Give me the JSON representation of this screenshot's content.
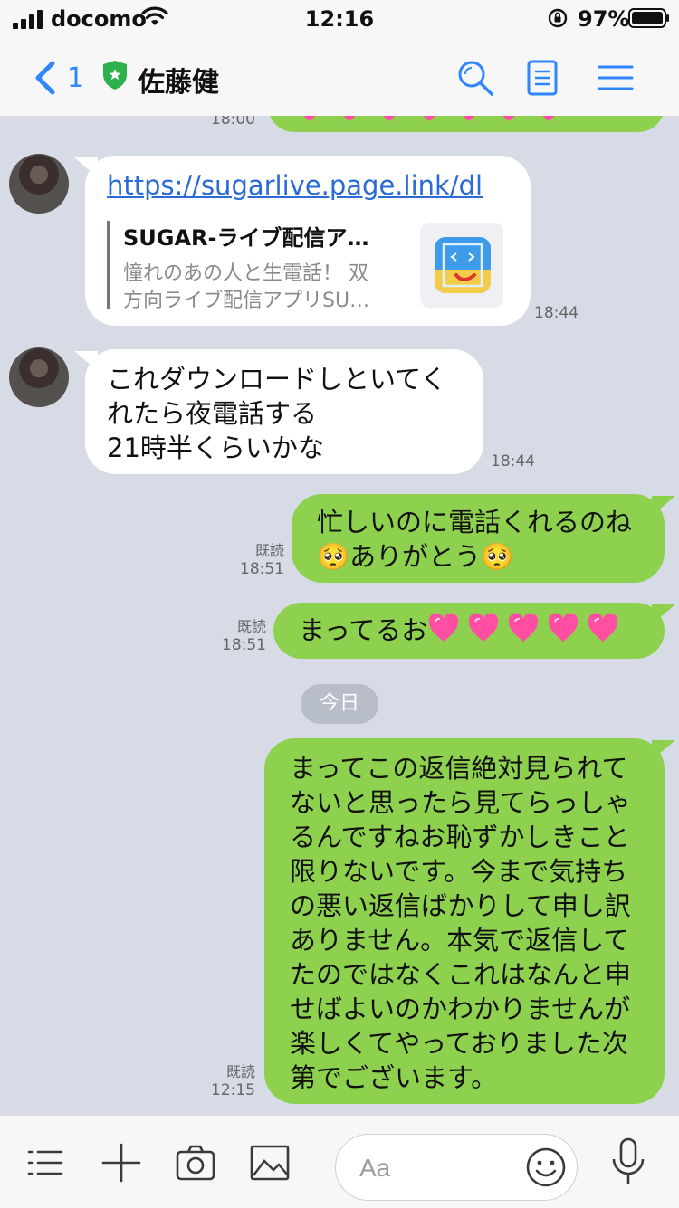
{
  "status_bar": {
    "carrier": "docomo",
    "time": "12:16",
    "battery_percent": "97%"
  },
  "header": {
    "back_count": "1",
    "contact_name": "佐藤健"
  },
  "chat": {
    "prev_time": "18:00",
    "messages": [
      {
        "id": "m1",
        "direction": "in",
        "link_url": "https://sugarlive.page.link/dl",
        "preview_title": "SUGAR-ライブ配信ア…",
        "preview_desc_line1": "憧れのあの人と生電話！ 双",
        "preview_desc_line2": "方向ライブ配信アプリSU…",
        "time": "18:44"
      },
      {
        "id": "m2",
        "direction": "in",
        "lines": [
          "これダウンロードしといてく",
          "れたら夜電話する",
          "21時半くらいかな"
        ],
        "time": "18:44"
      },
      {
        "id": "m3",
        "direction": "out",
        "line1": "忙しいのに電話くれるのね",
        "line2_emoji_left": "🥺",
        "line2_text": "ありがとう",
        "line2_emoji_right": "🥺",
        "read": "既読",
        "time": "18:51"
      },
      {
        "id": "m4",
        "direction": "out",
        "text": "まってるお",
        "heart_count": 5,
        "heart_color": "#ff4fa3",
        "read": "既読",
        "time": "18:51"
      }
    ],
    "date_separator": "今日",
    "last_message": {
      "direction": "out",
      "lines": [
        "まってこの返信絶対見られて",
        "ないと思ったら見てらっしゃ",
        "るんですねお恥ずかしきこと",
        "限りないです。今まで気持ち",
        "の悪い返信ばかりして申し訳",
        "ありません。本気で返信して",
        "たのではなくこれはなんと申",
        "せばよいのかわかりませんが",
        "楽しくてやっておりました次",
        "第でございます。"
      ],
      "read": "既読",
      "time": "12:15"
    }
  },
  "input": {
    "placeholder": "Aa"
  },
  "colors": {
    "background": "#d6dbe6",
    "outgoing_bubble": "#8ed14e",
    "incoming_bubble": "#ffffff",
    "accent": "#2f86ff",
    "shield": "#2db14a"
  }
}
